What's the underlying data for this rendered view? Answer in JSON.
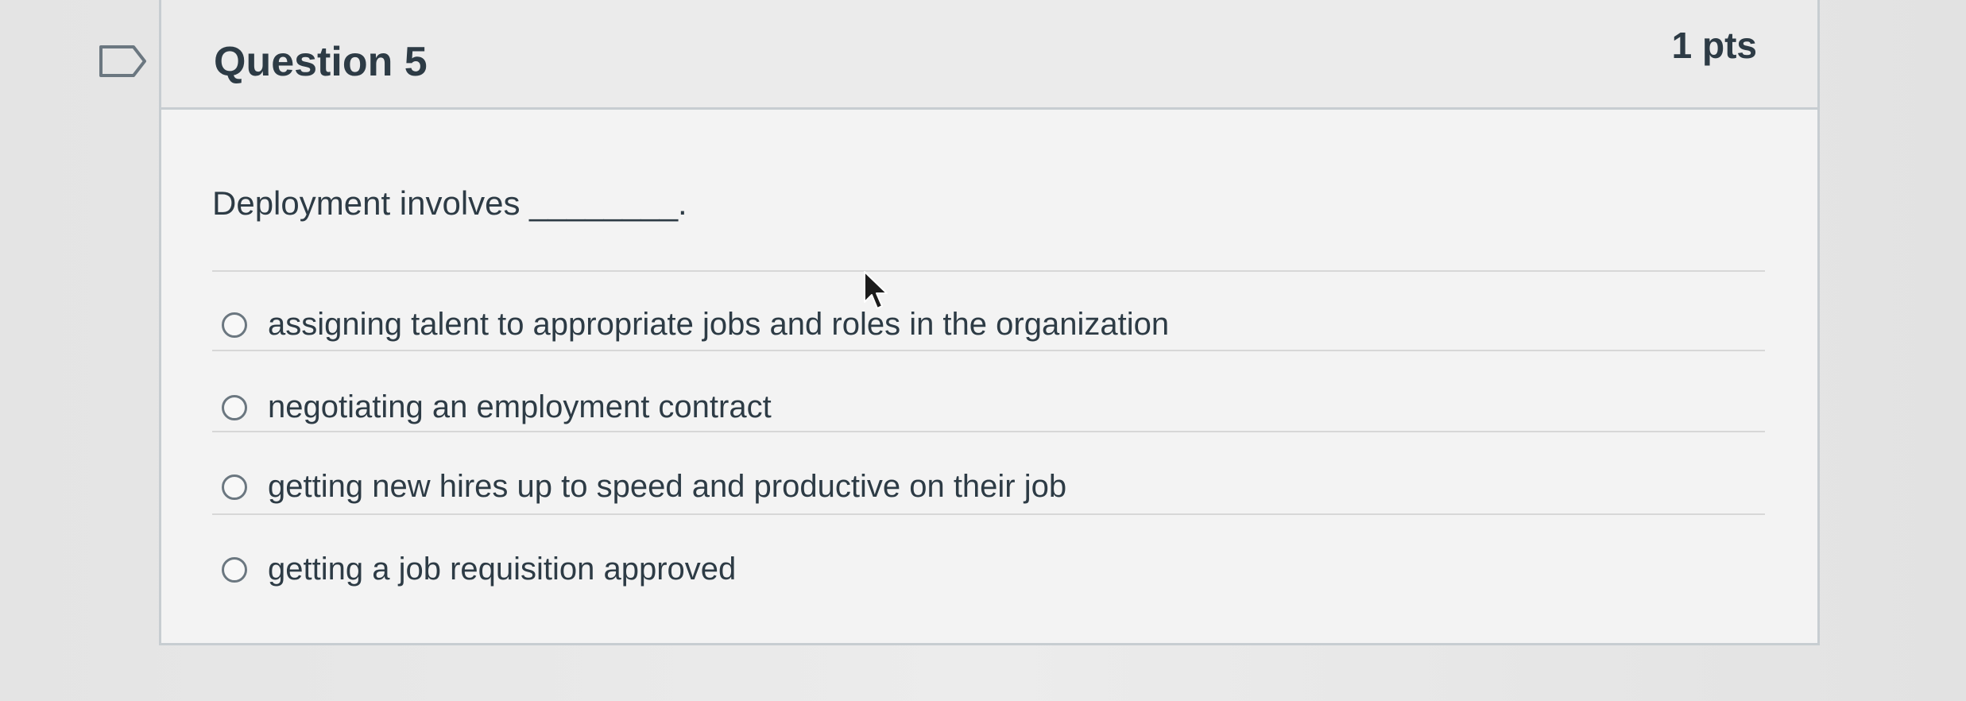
{
  "question": {
    "title": "Question 5",
    "points": "1 pts",
    "text": "Deployment involves ________.",
    "answers": [
      {
        "label": "assigning talent to appropriate jobs and roles in the organization"
      },
      {
        "label": "negotiating an employment contract"
      },
      {
        "label": "getting new hires up to speed and productive on their job"
      },
      {
        "label": "getting a job requisition approved"
      }
    ]
  },
  "icons": {
    "flag": "flag-question-icon",
    "cursor": "mouse-pointer-icon"
  }
}
